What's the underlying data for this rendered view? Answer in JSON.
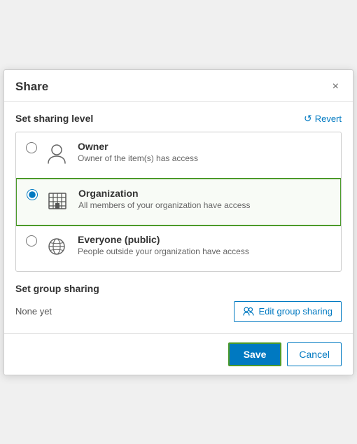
{
  "dialog": {
    "title": "Share",
    "close_label": "×"
  },
  "sharing_level": {
    "section_title": "Set sharing level",
    "revert_label": "Revert",
    "options": [
      {
        "id": "owner",
        "label": "Owner",
        "description": "Owner of the item(s) has access",
        "selected": false
      },
      {
        "id": "organization",
        "label": "Organization",
        "description": "All members of your organization have access",
        "selected": true
      },
      {
        "id": "everyone",
        "label": "Everyone (public)",
        "description": "People outside your organization have access",
        "selected": false
      }
    ]
  },
  "group_sharing": {
    "section_title": "Set group sharing",
    "none_yet_label": "None yet",
    "edit_button_label": "Edit group sharing"
  },
  "footer": {
    "save_label": "Save",
    "cancel_label": "Cancel"
  }
}
